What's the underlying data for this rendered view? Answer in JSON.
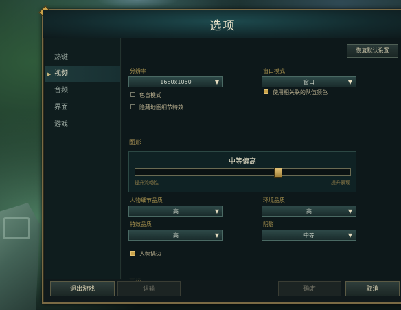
{
  "dialog": {
    "title": "选项"
  },
  "sidebar": {
    "items": [
      {
        "label": "热键",
        "active": false
      },
      {
        "label": "视频",
        "active": true
      },
      {
        "label": "音频",
        "active": false
      },
      {
        "label": "界面",
        "active": false
      },
      {
        "label": "游戏",
        "active": false
      }
    ]
  },
  "video": {
    "restore_defaults": "恢复默认设置",
    "resolution": {
      "label": "分辨率",
      "value": "1680x1050"
    },
    "window_mode": {
      "label": "窗口模式",
      "value": "窗口"
    },
    "colorblind": {
      "label": "色盲模式",
      "checked": false
    },
    "hide_eyecandy": {
      "label": "隐藏地图细节特效",
      "checked": false
    },
    "team_colors": {
      "label": "使用相关联的队伍颜色",
      "checked": true
    },
    "graphics": {
      "section": "图形",
      "preset": "中等偏高",
      "slider_value": 0.66,
      "min_label": "提升流畅性",
      "max_label": "提升表现"
    },
    "character_quality": {
      "label": "人物细节品质",
      "value": "高"
    },
    "environment_quality": {
      "label": "环境品质",
      "value": "高"
    },
    "effects_quality": {
      "label": "特效品质",
      "value": "高"
    },
    "shadows": {
      "label": "阴影",
      "value": "中等"
    },
    "character_inking": {
      "label": "人物描边",
      "checked": true
    },
    "advanced_section": "高级"
  },
  "buttons": {
    "exit_game": "退出游戏",
    "surrender": "认输",
    "ok": "确定",
    "cancel": "取消"
  },
  "icons": {
    "dropdown": "▼",
    "nav_arrow": "▶"
  }
}
